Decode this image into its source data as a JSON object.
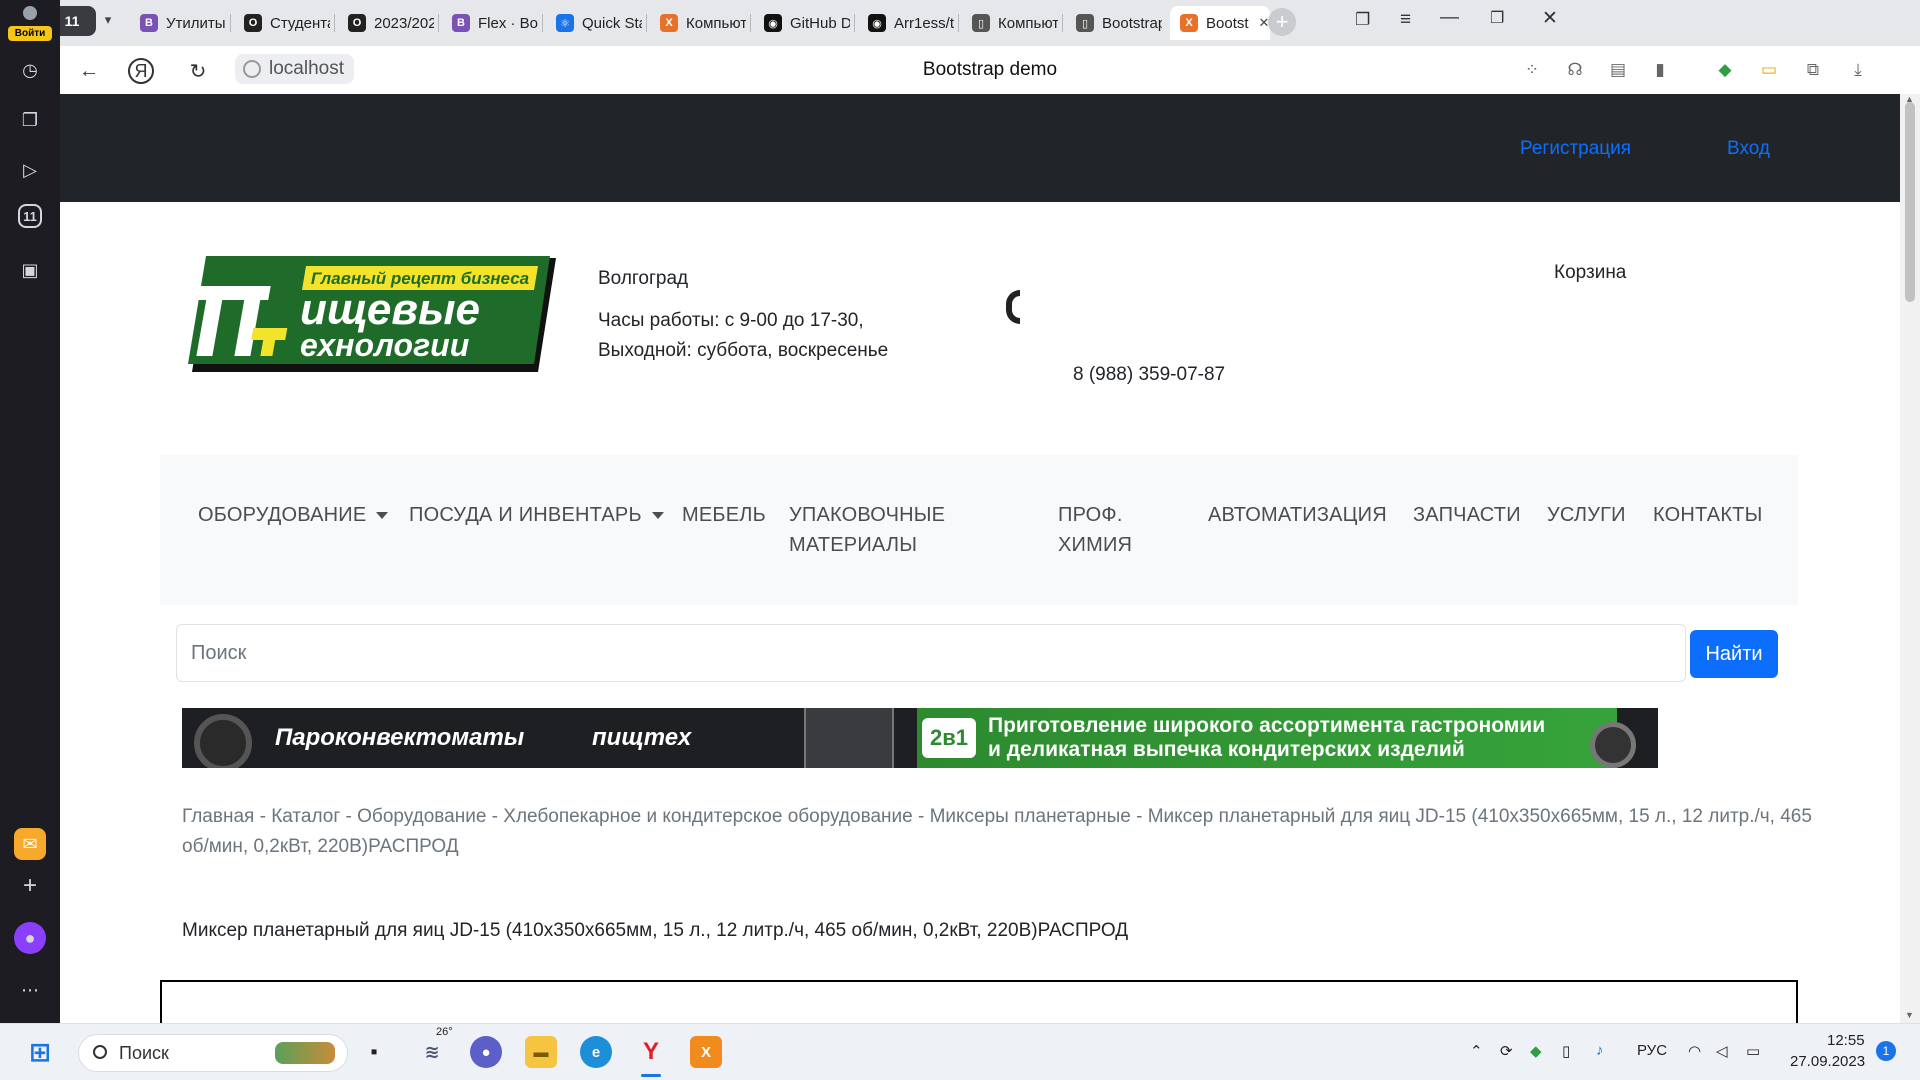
{
  "browser": {
    "login_label": "Войти",
    "tab_counter": "11",
    "tabs": [
      {
        "label": "Утилиты д",
        "fav": "B",
        "color": "#7952b3"
      },
      {
        "label": "Студента",
        "fav": "O",
        "color": "#222222"
      },
      {
        "label": "2023/202",
        "fav": "O",
        "color": "#222222"
      },
      {
        "label": "Flex · Boo",
        "fav": "B",
        "color": "#7952b3"
      },
      {
        "label": "Quick Sta",
        "fav": "⚛",
        "color": "#1a73e8"
      },
      {
        "label": "Компьют",
        "fav": "X",
        "color": "#e8712a"
      },
      {
        "label": "GitHub D",
        "fav": "◉",
        "color": "#111111"
      },
      {
        "label": "Arr1ess/t",
        "fav": "◉",
        "color": "#111111"
      },
      {
        "label": "Компьюте",
        "fav": "▯",
        "color": "#555555"
      },
      {
        "label": "Bootstrap",
        "fav": "▯",
        "color": "#555555"
      },
      {
        "label": "Bootst",
        "fav": "X",
        "color": "#e8712a"
      }
    ],
    "url": "localhost",
    "page_title": "Bootstrap demo"
  },
  "site": {
    "auth": {
      "register": "Регистрация",
      "login": "Вход"
    },
    "city": "Волгоград",
    "hours": "Часы работы: с 9-00 до 17-30,",
    "weekend": "Выходной: суббота, воскресенье",
    "phone": "8 (988) 359-07-87",
    "cart": "Корзина",
    "logo": {
      "slogan": "Главный рецепт бизнеса",
      "line1": "ищевые",
      "line2": "ехнологии"
    },
    "nav": [
      {
        "label": "ОБОРУДОВАНИЕ",
        "dropdown": true
      },
      {
        "label": "ПОСУДА И ИНВЕНТАРЬ",
        "dropdown": true
      },
      {
        "label": "МЕБЕЛЬ",
        "dropdown": false
      },
      {
        "label": "УПАКОВОЧНЫЕ МАТЕРИАЛЫ",
        "dropdown": false
      },
      {
        "label": "ПРОФ. ХИМИЯ",
        "dropdown": false
      },
      {
        "label": "АВТОМАТИЗАЦИЯ",
        "dropdown": false
      },
      {
        "label": "ЗАПЧАСТИ",
        "dropdown": false
      },
      {
        "label": "УСЛУГИ",
        "dropdown": false
      },
      {
        "label": "КОНТАКТЫ",
        "dropdown": false
      }
    ],
    "search": {
      "placeholder": "Поиск",
      "button": "Найти"
    },
    "banner": {
      "title": "Пароконвектоматы",
      "brand": "пищтех",
      "badge": "2в1",
      "line1": "Приготовление широкого ассортимента гастрономии",
      "line2": "и деликатная выпечка кондитерских изделий"
    },
    "breadcrumb": "Главная - Каталог - Оборудование - Хлебопекарное и кондитерское оборудование - Миксеры планетарные - Миксер планетарный для яиц JD-15 (410х350х665мм, 15 л., 12 литр./ч, 465 об/мин, 0,2кВт, 220В)РАСПРОД",
    "product_title": "Миксер планетарный для яиц JD-15 (410х350х665мм, 15 л., 12 литр./ч, 465 об/мин, 0,2кВт, 220В)РАСПРОД"
  },
  "taskbar": {
    "search_label": "Поиск",
    "weather": "26°",
    "lang": "РУС",
    "time": "12:55",
    "date": "27.09.2023",
    "notifications": "1"
  }
}
